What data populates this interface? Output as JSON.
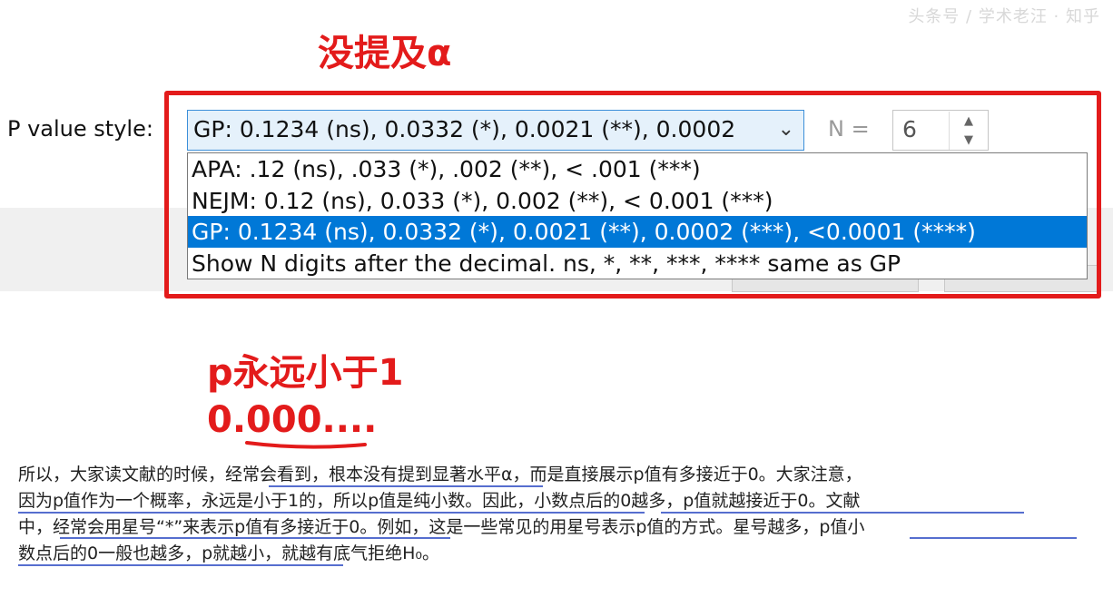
{
  "watermark": "头条号 / 学术老汪 · 知乎",
  "title_note": "没提及α",
  "p_value_style": {
    "label": "P value style:",
    "selected": "GP: 0.1234 (ns), 0.0332 (*), 0.0021 (**), 0.0002",
    "n_label": "N =",
    "n_value": "6",
    "options": [
      "APA:  .12 (ns), .033 (*), .002 (**), < .001 (***)",
      "NEJM: 0.12 (ns), 0.033 (*), 0.002 (**), < 0.001 (***)",
      "GP: 0.1234 (ns), 0.0332 (*), 0.0021 (**), 0.0002 (***), <0.0001 (****)",
      "Show N digits after the decimal. ns, *, **, ***, **** same as GP"
    ]
  },
  "note1": "p永远小于1",
  "note2": "0.000....",
  "paragraph": [
    "所以，大家读文献的时候，经常会看到，根本没有提到显著水平α，而是直接展示p值有多接近于0。大家注意，",
    "因为p值作为一个概率，永远是小于1的，所以p值是纯小数。因此，小数点后的0越多，p值就越接近于0。文献",
    "中，经常会用星号“*”来表示p值有多接近于0。例如，这是一些常见的用星号表示p值的方式。星号越多，p值小",
    "数点后的0一般也越多，p就越小，就越有底气拒绝H₀。"
  ],
  "colors": {
    "red": "#e31b1b",
    "underline_blue": "#1f3fbf",
    "selection": "#0078d7"
  }
}
